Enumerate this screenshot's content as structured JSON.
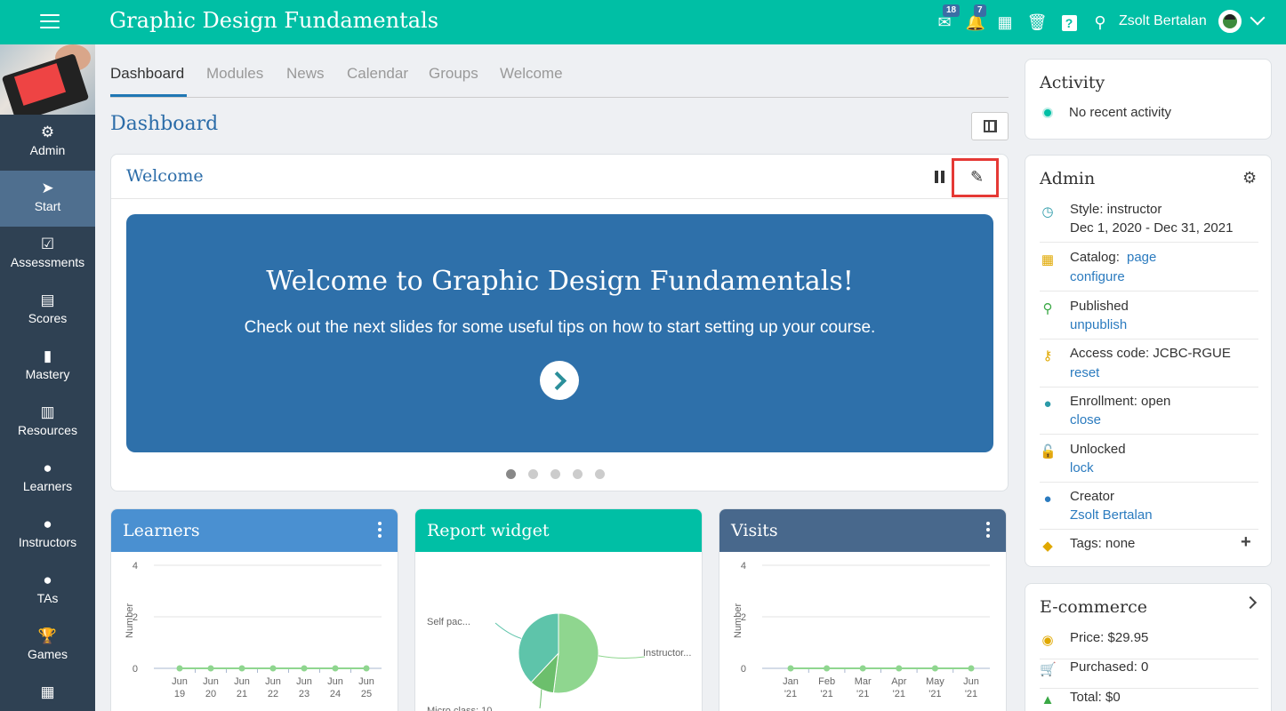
{
  "header": {
    "title": "Graphic Design Fundamentals",
    "messages_badge": "18",
    "notifications_badge": "7",
    "user_name": "Zsolt Bertalan",
    "accent_color": "#00bfa5"
  },
  "sidebar": {
    "items": [
      {
        "label": "Admin",
        "icon": "gear-icon",
        "glyph": "⚙"
      },
      {
        "label": "Start",
        "icon": "navigation-arrow-icon",
        "glyph": "➤"
      },
      {
        "label": "Assessments",
        "icon": "checklist-icon",
        "glyph": "☑"
      },
      {
        "label": "Scores",
        "icon": "gradebook-icon",
        "glyph": "▤"
      },
      {
        "label": "Mastery",
        "icon": "bar-chart-icon",
        "glyph": "▮"
      },
      {
        "label": "Resources",
        "icon": "books-icon",
        "glyph": "▥"
      },
      {
        "label": "Learners",
        "icon": "person-icon",
        "glyph": "●"
      },
      {
        "label": "Instructors",
        "icon": "instructor-icon",
        "glyph": "●"
      },
      {
        "label": "TAs",
        "icon": "ta-icon",
        "glyph": "●"
      },
      {
        "label": "Games",
        "icon": "trophy-icon",
        "glyph": "🏆"
      },
      {
        "label": "",
        "icon": "grid-icon",
        "glyph": "▦"
      }
    ]
  },
  "tabs": [
    "Dashboard",
    "Modules",
    "News",
    "Calendar",
    "Groups",
    "Welcome"
  ],
  "main": {
    "page_title": "Dashboard",
    "welcome": {
      "title": "Welcome",
      "slide_title": "Welcome to Graphic Design Fundamentals!",
      "slide_subtitle": "Check out the next slides for some useful tips on how to start setting up your course.",
      "slide_count": 5,
      "active_slide": 1
    },
    "widgets": {
      "learners_title": "Learners",
      "report_title": "Report widget",
      "visits_title": "Visits"
    }
  },
  "chart_data": [
    {
      "type": "line",
      "title": "Learners",
      "ylabel": "Number",
      "ylim": [
        0,
        4
      ],
      "y_ticks": [
        "4",
        "2",
        "0"
      ],
      "x": [
        [
          "Jun",
          "19"
        ],
        [
          "Jun",
          "20"
        ],
        [
          "Jun",
          "21"
        ],
        [
          "Jun",
          "22"
        ],
        [
          "Jun",
          "23"
        ],
        [
          "Jun",
          "24"
        ],
        [
          "Jun",
          "25"
        ]
      ],
      "values": [
        0,
        0,
        0,
        0,
        0,
        0,
        0
      ],
      "color": "#8fd68f"
    },
    {
      "type": "pie",
      "title": "Report widget",
      "slices": [
        {
          "label": "Instructor...",
          "value": 52,
          "color": "#8fd68f"
        },
        {
          "label": "Micro class: 10",
          "value": 10,
          "color": "#6cbf6c"
        },
        {
          "label": "Self pac...",
          "value": 38,
          "color": "#5ec4aa"
        }
      ]
    },
    {
      "type": "line",
      "title": "Visits",
      "ylabel": "Number",
      "ylim": [
        0,
        4
      ],
      "y_ticks": [
        "4",
        "2",
        "0"
      ],
      "x": [
        [
          "Jan",
          "'21"
        ],
        [
          "Feb",
          "'21"
        ],
        [
          "Mar",
          "'21"
        ],
        [
          "Apr",
          "'21"
        ],
        [
          "May",
          "'21"
        ],
        [
          "Jun",
          "'21"
        ]
      ],
      "values": [
        0,
        0,
        0,
        0,
        0,
        0
      ],
      "color": "#8fd68f"
    }
  ],
  "activity": {
    "title": "Activity",
    "text": "No recent activity"
  },
  "admin_panel": {
    "title": "Admin",
    "rows": [
      {
        "icon": "clock-icon",
        "text": "Style: instructor",
        "second": "Dec 1, 2020 - Dec 31, 2021",
        "second_is_link": false
      },
      {
        "icon": "catalog-icon",
        "text": "Catalog:",
        "inline_link": "page",
        "second": "configure",
        "second_is_link": true
      },
      {
        "icon": "search-icon",
        "text": "Published",
        "second": "unpublish",
        "second_is_link": true
      },
      {
        "icon": "key-icon",
        "text": "Access code: JCBC-RGUE",
        "second": "reset",
        "second_is_link": true
      },
      {
        "icon": "group-icon",
        "text": "Enrollment: open",
        "second": "close",
        "second_is_link": true
      },
      {
        "icon": "unlock-icon",
        "text": "Unlocked",
        "second": "lock",
        "second_is_link": true
      },
      {
        "icon": "person-icon",
        "text": "Creator",
        "second": "Zsolt Bertalan",
        "second_is_link": true
      },
      {
        "icon": "tag-icon",
        "text": "Tags: none"
      }
    ]
  },
  "ecommerce": {
    "title": "E-commerce",
    "rows": [
      {
        "icon": "coins-icon",
        "text": "Price: $29.95"
      },
      {
        "icon": "cart-icon",
        "text": "Purchased: 0"
      },
      {
        "icon": "trend-icon",
        "text": "Total: $0"
      }
    ]
  }
}
